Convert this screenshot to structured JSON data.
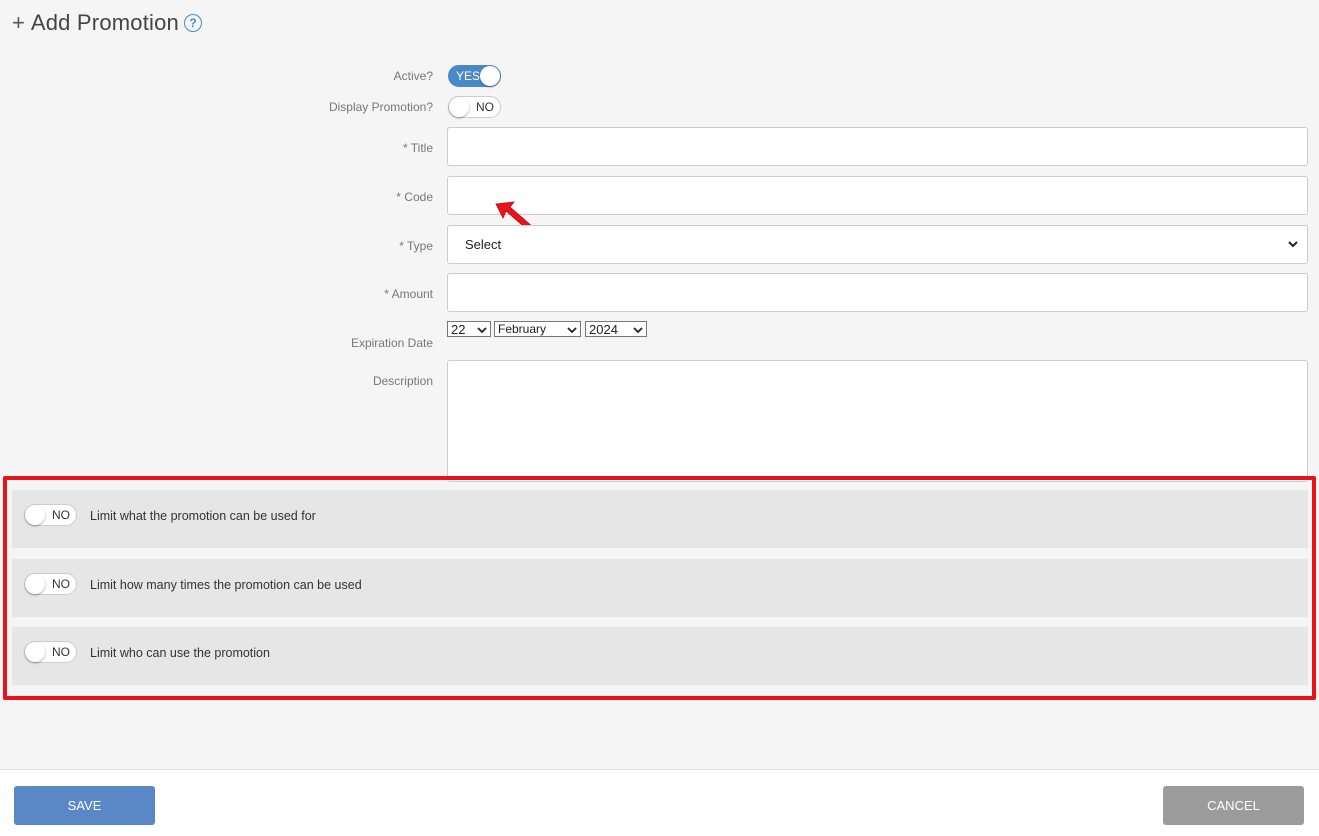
{
  "header": {
    "title": "Add Promotion",
    "plus_icon": "+",
    "help_icon": "?"
  },
  "form": {
    "active_label": "Active?",
    "active_toggle": "YES",
    "display_label": "Display Promotion?",
    "display_toggle": "NO",
    "title_label": "* Title",
    "title_value": "",
    "code_label": "* Code",
    "code_value": "",
    "type_label": "* Type",
    "type_value": "Select",
    "amount_label": "* Amount",
    "amount_value": "",
    "expiration_label": "Expiration Date",
    "exp_day": "22",
    "exp_month": "February",
    "exp_year": "2024",
    "description_label": "Description",
    "description_value": ""
  },
  "limits": [
    {
      "toggle": "NO",
      "text": "Limit what the promotion can be used for"
    },
    {
      "toggle": "NO",
      "text": "Limit how many times the promotion can be used"
    },
    {
      "toggle": "NO",
      "text": "Limit who can use the promotion"
    }
  ],
  "footer": {
    "save_label": "SAVE",
    "cancel_label": "CANCEL"
  },
  "colors": {
    "accent": "#4a89c8",
    "highlight": "#e8141b",
    "save": "#5a87c6",
    "cancel": "#9b9b9b"
  }
}
